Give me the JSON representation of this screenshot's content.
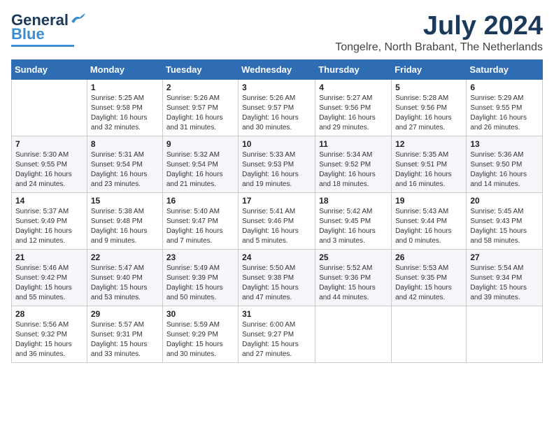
{
  "header": {
    "logo_general": "General",
    "logo_blue": "Blue",
    "month_year": "July 2024",
    "location": "Tongelre, North Brabant, The Netherlands"
  },
  "days_of_week": [
    "Sunday",
    "Monday",
    "Tuesday",
    "Wednesday",
    "Thursday",
    "Friday",
    "Saturday"
  ],
  "weeks": [
    [
      {
        "day": "",
        "sunrise": "",
        "sunset": "",
        "daylight": ""
      },
      {
        "day": "1",
        "sunrise": "Sunrise: 5:25 AM",
        "sunset": "Sunset: 9:58 PM",
        "daylight": "Daylight: 16 hours and 32 minutes."
      },
      {
        "day": "2",
        "sunrise": "Sunrise: 5:26 AM",
        "sunset": "Sunset: 9:57 PM",
        "daylight": "Daylight: 16 hours and 31 minutes."
      },
      {
        "day": "3",
        "sunrise": "Sunrise: 5:26 AM",
        "sunset": "Sunset: 9:57 PM",
        "daylight": "Daylight: 16 hours and 30 minutes."
      },
      {
        "day": "4",
        "sunrise": "Sunrise: 5:27 AM",
        "sunset": "Sunset: 9:56 PM",
        "daylight": "Daylight: 16 hours and 29 minutes."
      },
      {
        "day": "5",
        "sunrise": "Sunrise: 5:28 AM",
        "sunset": "Sunset: 9:56 PM",
        "daylight": "Daylight: 16 hours and 27 minutes."
      },
      {
        "day": "6",
        "sunrise": "Sunrise: 5:29 AM",
        "sunset": "Sunset: 9:55 PM",
        "daylight": "Daylight: 16 hours and 26 minutes."
      }
    ],
    [
      {
        "day": "7",
        "sunrise": "Sunrise: 5:30 AM",
        "sunset": "Sunset: 9:55 PM",
        "daylight": "Daylight: 16 hours and 24 minutes."
      },
      {
        "day": "8",
        "sunrise": "Sunrise: 5:31 AM",
        "sunset": "Sunset: 9:54 PM",
        "daylight": "Daylight: 16 hours and 23 minutes."
      },
      {
        "day": "9",
        "sunrise": "Sunrise: 5:32 AM",
        "sunset": "Sunset: 9:54 PM",
        "daylight": "Daylight: 16 hours and 21 minutes."
      },
      {
        "day": "10",
        "sunrise": "Sunrise: 5:33 AM",
        "sunset": "Sunset: 9:53 PM",
        "daylight": "Daylight: 16 hours and 19 minutes."
      },
      {
        "day": "11",
        "sunrise": "Sunrise: 5:34 AM",
        "sunset": "Sunset: 9:52 PM",
        "daylight": "Daylight: 16 hours and 18 minutes."
      },
      {
        "day": "12",
        "sunrise": "Sunrise: 5:35 AM",
        "sunset": "Sunset: 9:51 PM",
        "daylight": "Daylight: 16 hours and 16 minutes."
      },
      {
        "day": "13",
        "sunrise": "Sunrise: 5:36 AM",
        "sunset": "Sunset: 9:50 PM",
        "daylight": "Daylight: 16 hours and 14 minutes."
      }
    ],
    [
      {
        "day": "14",
        "sunrise": "Sunrise: 5:37 AM",
        "sunset": "Sunset: 9:49 PM",
        "daylight": "Daylight: 16 hours and 12 minutes."
      },
      {
        "day": "15",
        "sunrise": "Sunrise: 5:38 AM",
        "sunset": "Sunset: 9:48 PM",
        "daylight": "Daylight: 16 hours and 9 minutes."
      },
      {
        "day": "16",
        "sunrise": "Sunrise: 5:40 AM",
        "sunset": "Sunset: 9:47 PM",
        "daylight": "Daylight: 16 hours and 7 minutes."
      },
      {
        "day": "17",
        "sunrise": "Sunrise: 5:41 AM",
        "sunset": "Sunset: 9:46 PM",
        "daylight": "Daylight: 16 hours and 5 minutes."
      },
      {
        "day": "18",
        "sunrise": "Sunrise: 5:42 AM",
        "sunset": "Sunset: 9:45 PM",
        "daylight": "Daylight: 16 hours and 3 minutes."
      },
      {
        "day": "19",
        "sunrise": "Sunrise: 5:43 AM",
        "sunset": "Sunset: 9:44 PM",
        "daylight": "Daylight: 16 hours and 0 minutes."
      },
      {
        "day": "20",
        "sunrise": "Sunrise: 5:45 AM",
        "sunset": "Sunset: 9:43 PM",
        "daylight": "Daylight: 15 hours and 58 minutes."
      }
    ],
    [
      {
        "day": "21",
        "sunrise": "Sunrise: 5:46 AM",
        "sunset": "Sunset: 9:42 PM",
        "daylight": "Daylight: 15 hours and 55 minutes."
      },
      {
        "day": "22",
        "sunrise": "Sunrise: 5:47 AM",
        "sunset": "Sunset: 9:40 PM",
        "daylight": "Daylight: 15 hours and 53 minutes."
      },
      {
        "day": "23",
        "sunrise": "Sunrise: 5:49 AM",
        "sunset": "Sunset: 9:39 PM",
        "daylight": "Daylight: 15 hours and 50 minutes."
      },
      {
        "day": "24",
        "sunrise": "Sunrise: 5:50 AM",
        "sunset": "Sunset: 9:38 PM",
        "daylight": "Daylight: 15 hours and 47 minutes."
      },
      {
        "day": "25",
        "sunrise": "Sunrise: 5:52 AM",
        "sunset": "Sunset: 9:36 PM",
        "daylight": "Daylight: 15 hours and 44 minutes."
      },
      {
        "day": "26",
        "sunrise": "Sunrise: 5:53 AM",
        "sunset": "Sunset: 9:35 PM",
        "daylight": "Daylight: 15 hours and 42 minutes."
      },
      {
        "day": "27",
        "sunrise": "Sunrise: 5:54 AM",
        "sunset": "Sunset: 9:34 PM",
        "daylight": "Daylight: 15 hours and 39 minutes."
      }
    ],
    [
      {
        "day": "28",
        "sunrise": "Sunrise: 5:56 AM",
        "sunset": "Sunset: 9:32 PM",
        "daylight": "Daylight: 15 hours and 36 minutes."
      },
      {
        "day": "29",
        "sunrise": "Sunrise: 5:57 AM",
        "sunset": "Sunset: 9:31 PM",
        "daylight": "Daylight: 15 hours and 33 minutes."
      },
      {
        "day": "30",
        "sunrise": "Sunrise: 5:59 AM",
        "sunset": "Sunset: 9:29 PM",
        "daylight": "Daylight: 15 hours and 30 minutes."
      },
      {
        "day": "31",
        "sunrise": "Sunrise: 6:00 AM",
        "sunset": "Sunset: 9:27 PM",
        "daylight": "Daylight: 15 hours and 27 minutes."
      },
      {
        "day": "",
        "sunrise": "",
        "sunset": "",
        "daylight": ""
      },
      {
        "day": "",
        "sunrise": "",
        "sunset": "",
        "daylight": ""
      },
      {
        "day": "",
        "sunrise": "",
        "sunset": "",
        "daylight": ""
      }
    ]
  ]
}
